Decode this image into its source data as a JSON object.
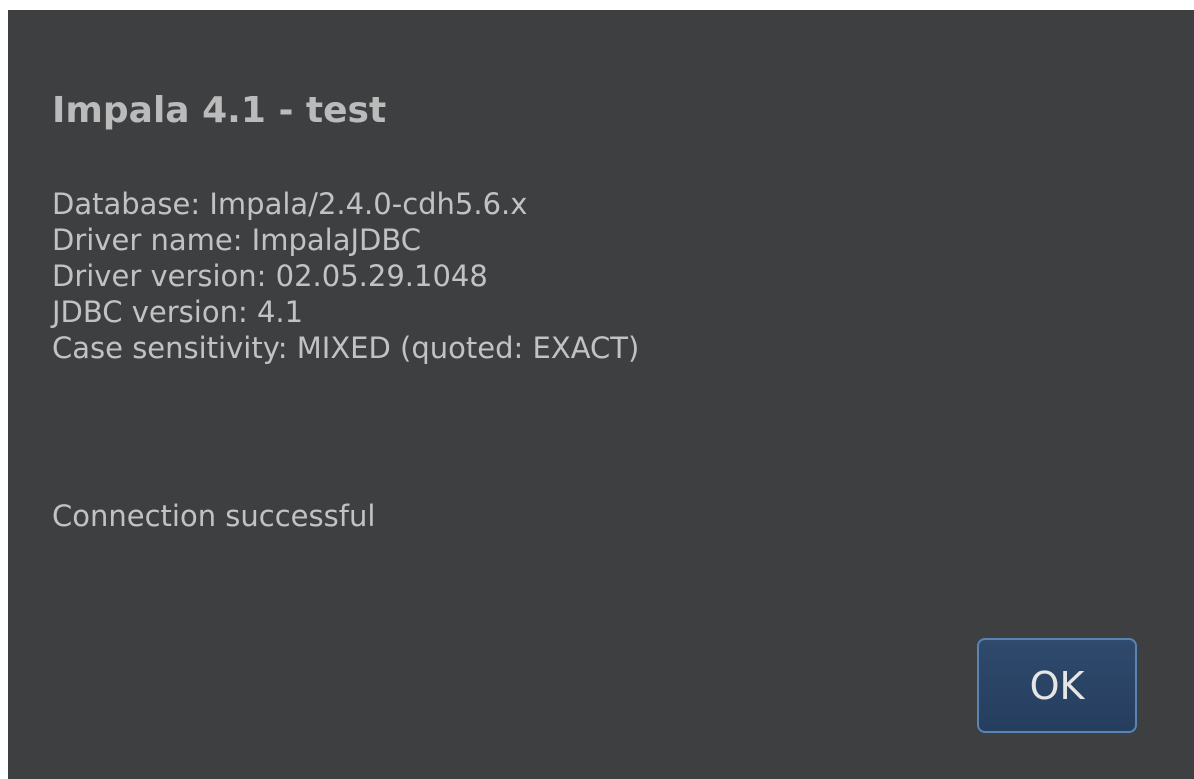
{
  "dialog": {
    "title": "Impala 4.1 - test",
    "info_lines": [
      "Database: Impala/2.4.0-cdh5.6.x",
      "Driver name: ImpalaJDBC",
      "Driver version: 02.05.29.1048",
      "JDBC version: 4.1",
      "Case sensitivity: MIXED (quoted: EXACT)"
    ],
    "status": "Connection successful",
    "ok_label": "OK"
  },
  "colors": {
    "dialog_background": "#3d3f41",
    "text": "#c2c2c2",
    "button_background": "#2f4a6d",
    "button_border": "#5a84b4"
  }
}
